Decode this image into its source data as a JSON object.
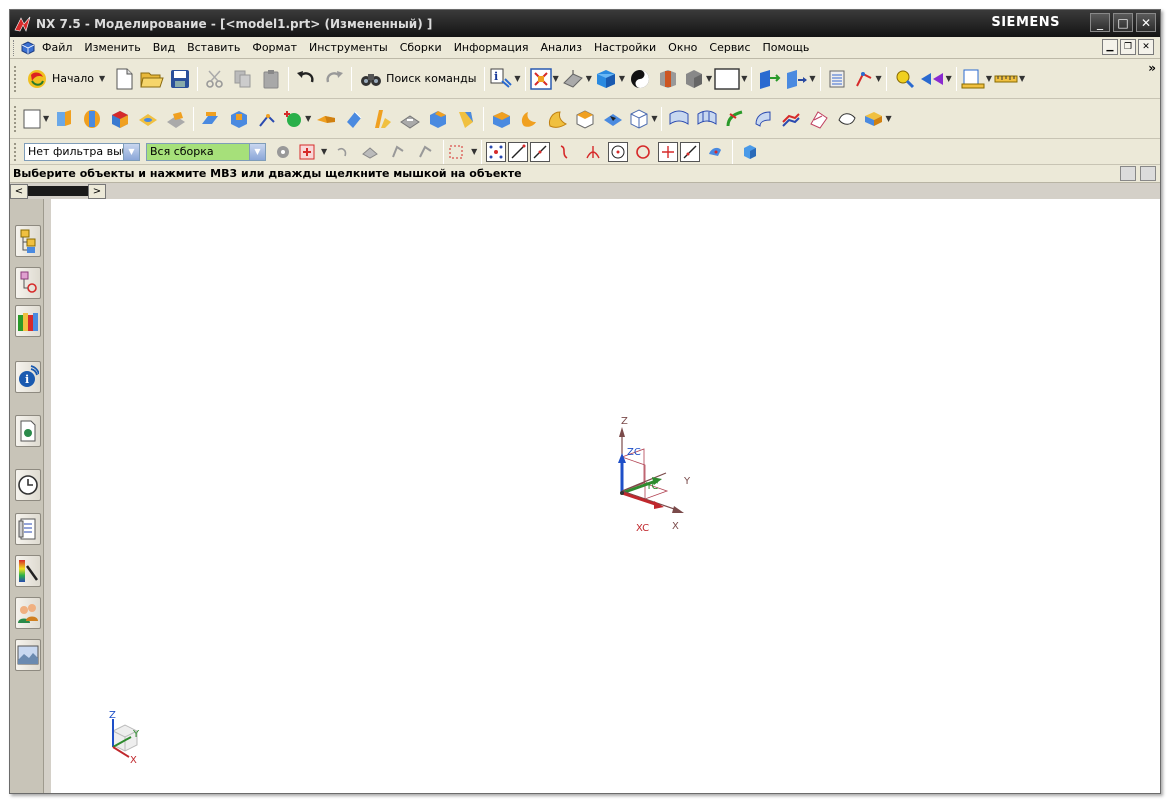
{
  "window": {
    "title": "NX 7.5 - Моделирование - [<model1.prt> (Измененный) ]",
    "brand": "SIEMENS",
    "buttons": {
      "minimize": "_",
      "maximize": "□",
      "close": "✕"
    }
  },
  "menu": {
    "items": [
      "Файл",
      "Изменить",
      "Вид",
      "Вставить",
      "Формат",
      "Инструменты",
      "Сборки",
      "Информация",
      "Анализ",
      "Настройки",
      "Окно",
      "Сервис",
      "Помощь"
    ]
  },
  "toolbar1": {
    "start_label": "Начало",
    "command_search_label": "Поиск команды",
    "overflow": "»"
  },
  "filters": {
    "type_filter": "Нет фильтра выбо",
    "scope_filter": "Вся сборка"
  },
  "status": {
    "prompt": "Выберите объекты и нажмите MB3 или дважды щелкните мышкой на объекте"
  },
  "tabs": {
    "left_arrow": "<",
    "right_arrow": ">"
  },
  "csys": {
    "z": "Z",
    "zc": "ZC",
    "y": "Y",
    "yc": "YC",
    "x": "X",
    "xc": "XC"
  },
  "triad": {
    "z": "Z",
    "y": "Y",
    "x": "X"
  },
  "colors": {
    "titlebar": "#1a1a1a",
    "menubar": "#ece9d8",
    "viewport": "#ffffff",
    "axis_x": "#c0282d",
    "axis_y": "#2e8b2e",
    "axis_z": "#1e4fc8",
    "filter_green": "#a6e07a"
  },
  "icons": {
    "toolbar1": [
      "start-icon",
      "new-file-icon",
      "open-folder-icon",
      "save-icon",
      "cut-icon",
      "copy-icon",
      "paste-icon",
      "undo-icon",
      "redo-icon",
      "binoculars-icon",
      "info-icon",
      "fit-view-icon",
      "orient-view-icon",
      "shaded-cube-icon",
      "rendering-style-icon",
      "section-icon",
      "hidden-cube-icon",
      "background-icon",
      "wcs-icon",
      "move-icon",
      "layer-icon",
      "snap-icon",
      "analysis-icon",
      "measure-icon",
      "ruler-icon"
    ],
    "toolbar2": [
      "sketch-icon",
      "extrude-icon",
      "revolve-icon",
      "block-icon",
      "hole-icon",
      "boss-icon",
      "pad-icon",
      "pocket-icon",
      "datum-icon",
      "point-icon",
      "rib-icon",
      "draft-icon",
      "blend-icon",
      "chamfer-icon",
      "shell-icon",
      "unite-icon",
      "subtract-icon",
      "trim-icon",
      "edge-blend-icon",
      "offset-icon",
      "thicken-icon",
      "sew-icon",
      "surface-icon",
      "mesh-icon",
      "through-curves-icon",
      "law-icon",
      "sweep-icon",
      "bridge-icon",
      "swoop-icon",
      "n-sided-icon"
    ],
    "toolbar3": [
      "select-all-icon",
      "undo-select-icon",
      "feature-select-icon",
      "body-select-icon",
      "face-select-icon",
      "snap-point-icon",
      "end-point-icon",
      "mid-point-icon",
      "control-point-icon",
      "intersection-icon",
      "arc-center-icon",
      "quadrant-icon",
      "existing-point-icon",
      "point-on-curve-icon",
      "point-on-surface-icon",
      "bounded-grid-icon"
    ],
    "resources": [
      "assembly-navigator-icon",
      "constraint-navigator-icon",
      "part-navigator-icon",
      "hd3d-icon",
      "web-browser-icon",
      "history-icon",
      "reuse-library-icon",
      "palette-icon",
      "roles-icon",
      "system-scenes-icon"
    ]
  }
}
